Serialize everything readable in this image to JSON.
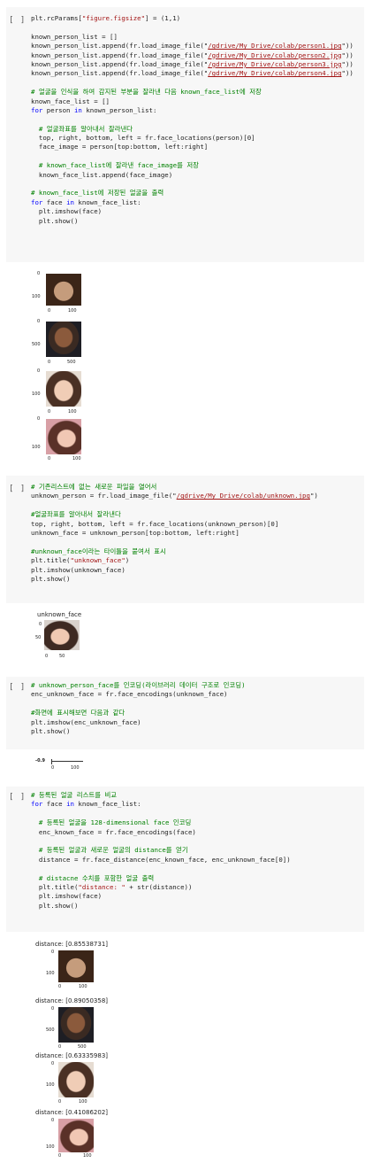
{
  "run_label": "[ ]",
  "cells": [
    {
      "lines": [
        [
          [
            "plt.rcParams[",
            ""
          ],
          [
            "\"figure.figsize\"",
            "str"
          ],
          [
            "] = (1,1)",
            ""
          ]
        ],
        [],
        [
          [
            "known_person_list = []",
            ""
          ]
        ],
        [
          [
            "known_person_list.append(fr.load_image_file(\"",
            ""
          ],
          [
            "/gdrive/My Drive/colab/person1.jpg",
            "link"
          ],
          [
            "\"))",
            ""
          ]
        ],
        [
          [
            "known_person_list.append(fr.load_image_file(\"",
            ""
          ],
          [
            "/gdrive/My Drive/colab/person2.jpg",
            "link"
          ],
          [
            "\"))",
            ""
          ]
        ],
        [
          [
            "known_person_list.append(fr.load_image_file(\"",
            ""
          ],
          [
            "/gdrive/My Drive/colab/person3.jpg",
            "link"
          ],
          [
            "\"))",
            ""
          ]
        ],
        [
          [
            "known_person_list.append(fr.load_image_file(\"",
            ""
          ],
          [
            "/gdrive/My Drive/colab/person4.jpg",
            "link"
          ],
          [
            "\"))",
            ""
          ]
        ],
        [],
        [
          [
            "# 얼굴을 인식을 하여 감지된 부분을 잘라낸 다음 known_face_list에 저장",
            "cm"
          ]
        ],
        [
          [
            "known_face_list = []",
            ""
          ]
        ],
        [
          [
            "for",
            "kw"
          ],
          [
            " person ",
            ""
          ],
          [
            "in",
            "kw"
          ],
          [
            " known_person_list:",
            ""
          ]
        ],
        [],
        [
          [
            "  # 얼굴좌표를 알아내서 잘라낸다",
            "cm"
          ]
        ],
        [
          [
            "  top, right, bottom, left = fr.face_locations(person)[0]",
            ""
          ]
        ],
        [
          [
            "  face_image = person[top:bottom, left:right]",
            ""
          ]
        ],
        [],
        [
          [
            "  # known_face_list에 잘라낸 face_image를 저장",
            "cm"
          ]
        ],
        [
          [
            "  known_face_list.append(face_image)",
            ""
          ]
        ],
        [],
        [
          [
            "# known_face_list에 저장된 얼굴을 출력",
            "cm"
          ]
        ],
        [
          [
            "for",
            "kw"
          ],
          [
            " face ",
            ""
          ],
          [
            "in",
            "kw"
          ],
          [
            " known_face_list:",
            ""
          ]
        ],
        [
          [
            "  plt.imshow(face)",
            ""
          ]
        ],
        [
          [
            "  plt.show()",
            ""
          ]
        ]
      ]
    },
    {
      "lines": [
        [
          [
            "# 기존리스트에 없는 새로운 파일을 열어서",
            "cm"
          ]
        ],
        [
          [
            "unknown_person = fr.load_image_file(\"",
            ""
          ],
          [
            "/gdrive/My Drive/colab/unknown.jpg",
            "link"
          ],
          [
            "\")",
            ""
          ]
        ],
        [],
        [
          [
            "#얼굴좌표를 알아내서 잘라낸다",
            "cm"
          ]
        ],
        [
          [
            "top, right, bottom, left = fr.face_locations(unknown_person)[0]",
            ""
          ]
        ],
        [
          [
            "unknown_face = unknown_person[top:bottom, left:right]",
            ""
          ]
        ],
        [],
        [
          [
            "#unknown_face이라는 타이틀을 붙여서 표시",
            "cm"
          ]
        ],
        [
          [
            "plt.title(",
            ""
          ],
          [
            "\"unknown_face\"",
            "str"
          ],
          [
            ")",
            ""
          ]
        ],
        [
          [
            "plt.imshow(unknown_face)",
            ""
          ]
        ],
        [
          [
            "plt.show()",
            ""
          ]
        ]
      ]
    },
    {
      "lines": [
        [
          [
            "# unknown_person_face를 인코딩(라이브러리 데이터 구조로 인코딩)",
            "cm"
          ]
        ],
        [
          [
            "enc_unknown_face = fr.face_encodings(unknown_face)",
            ""
          ]
        ],
        [],
        [
          [
            "#화면에 표시해보면 다음과 같다",
            "cm"
          ]
        ],
        [
          [
            "plt.imshow(enc_unknown_face)",
            ""
          ]
        ],
        [
          [
            "plt.show()",
            ""
          ]
        ]
      ]
    },
    {
      "lines": [
        [
          [
            "# 등록된 얼굴 리스트를 비교",
            "cm"
          ]
        ],
        [
          [
            "for",
            "kw"
          ],
          [
            " face ",
            ""
          ],
          [
            "in",
            "kw"
          ],
          [
            " known_face_list:",
            ""
          ]
        ],
        [],
        [
          [
            "  # 등록된 얼굴을 128-dimensional face 인코딩",
            "cm"
          ]
        ],
        [
          [
            "  enc_known_face = fr.face_encodings(face)",
            ""
          ]
        ],
        [],
        [
          [
            "  # 등록된 얼굴과 새로운 얼굴의 distance를 얻기",
            "cm"
          ]
        ],
        [
          [
            "  distance = fr.face_distance(enc_known_face, enc_unknown_face[0])",
            ""
          ]
        ],
        [],
        [
          [
            "  # distacne 수치를 포함한 얼굴 출력",
            "cm"
          ]
        ],
        [
          [
            "  plt.title(",
            ""
          ],
          [
            "\"distance: \"",
            "str"
          ],
          [
            " + str(distance))",
            ""
          ]
        ],
        [
          [
            "  plt.imshow(face)",
            ""
          ]
        ],
        [
          [
            "  plt.show()",
            ""
          ]
        ]
      ]
    }
  ],
  "outputs": {
    "known_faces": [
      {
        "yticks": [
          "0",
          "100"
        ],
        "xticks": [
          "0",
          "100"
        ]
      },
      {
        "yticks": [
          "0",
          "500"
        ],
        "xticks": [
          "0",
          "500"
        ]
      },
      {
        "yticks": [
          "0",
          "100"
        ],
        "xticks": [
          "0",
          "100"
        ]
      },
      {
        "yticks": [
          "0",
          "100"
        ],
        "xticks": [
          "0",
          "100"
        ]
      }
    ],
    "unknown_face": {
      "title": "unknown_face",
      "yticks": [
        "0",
        "50"
      ],
      "xticks": [
        "0",
        "50"
      ]
    },
    "encoding_plot": {
      "ytick": "-0.9",
      "xticks": [
        "0",
        "100"
      ]
    },
    "distances": [
      {
        "title": "distance: [0.85538731]",
        "yticks": [
          "0",
          "100"
        ],
        "xticks": [
          "0",
          "100"
        ]
      },
      {
        "title": "distance: [0.89050358]",
        "yticks": [
          "0",
          "500"
        ],
        "xticks": [
          "0",
          "500"
        ]
      },
      {
        "title": "distance: [0.63335983]",
        "yticks": [
          "0",
          "100"
        ],
        "xticks": [
          "0",
          "100"
        ]
      },
      {
        "title": "distance: [0.41086202]",
        "yticks": [
          "0",
          "100"
        ],
        "xticks": [
          "0",
          "100"
        ]
      }
    ]
  }
}
